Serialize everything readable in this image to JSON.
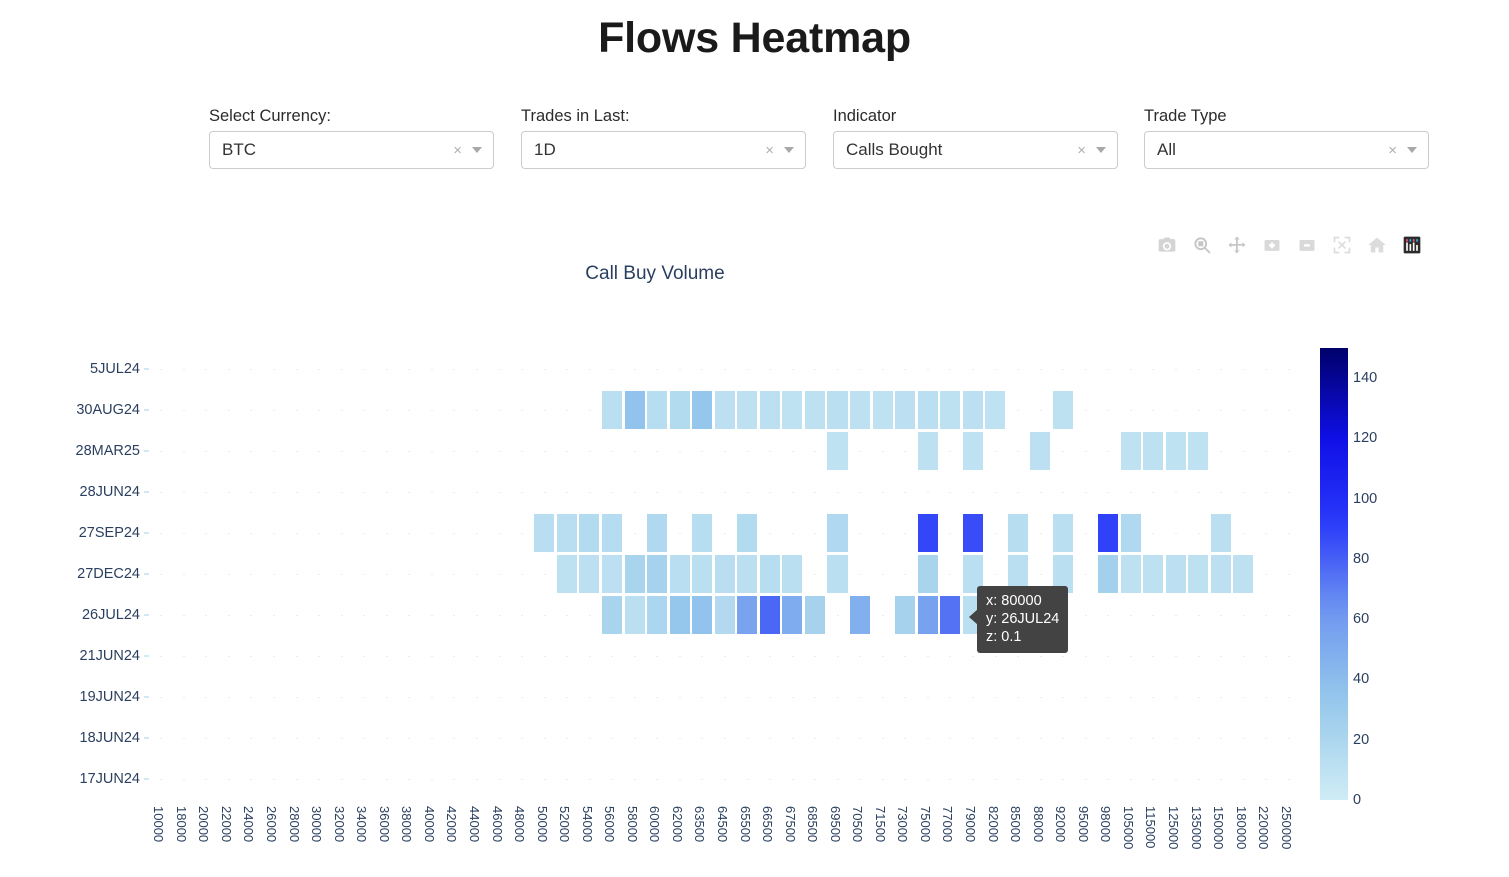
{
  "header": {
    "title": "Flows Heatmap"
  },
  "filters": [
    {
      "label": "Select Currency:",
      "value": "BTC",
      "clear": "×",
      "name": "currency"
    },
    {
      "label": "Trades in Last:",
      "value": "1D",
      "clear": "×",
      "name": "trades-in-last"
    },
    {
      "label": "Indicator",
      "value": "Calls Bought",
      "clear": "×",
      "name": "indicator"
    },
    {
      "label": "Trade Type",
      "value": "All",
      "clear": "×",
      "name": "trade-type"
    }
  ],
  "modebar": [
    {
      "name": "download-plot-icon",
      "title": "Download plot as a png"
    },
    {
      "name": "zoom-icon",
      "title": "Zoom"
    },
    {
      "name": "pan-icon",
      "title": "Pan"
    },
    {
      "name": "zoom-in-icon",
      "title": "Zoom in"
    },
    {
      "name": "zoom-out-icon",
      "title": "Zoom out"
    },
    {
      "name": "autoscale-icon",
      "title": "Autoscale"
    },
    {
      "name": "reset-axes-icon",
      "title": "Reset axes"
    },
    {
      "name": "plotly-logo-icon",
      "title": "Produced with Plotly"
    }
  ],
  "tooltip": {
    "x": "x: 80000",
    "y": "y: 26JUL24",
    "z": "z: 0.1"
  },
  "colors": {
    "title": "#1a1a1a",
    "axis_text": "#2a3f5f",
    "colorscale_low": "#cfecf5",
    "colorscale_mid": "#1515ff",
    "colorscale_high": "#00006b",
    "tooltip_bg": "#434343",
    "highlight": "#00007f"
  },
  "chart_data": {
    "type": "heatmap",
    "title": "Call Buy Volume",
    "xlabel": "",
    "ylabel": "",
    "zmin": 0,
    "zmax": 150,
    "colorbar_ticks": [
      0,
      20,
      40,
      60,
      80,
      100,
      120,
      140
    ],
    "colorbar_title": "",
    "grid": true,
    "legend_position": "right",
    "y_categories": [
      "5JUL24",
      "30AUG24",
      "28MAR25",
      "28JUN24",
      "27SEP24",
      "27DEC24",
      "26JUL24",
      "21JUN24",
      "19JUN24",
      "18JUN24",
      "17JUN24"
    ],
    "x_categories": [
      "10000",
      "18000",
      "20000",
      "22000",
      "24000",
      "26000",
      "28000",
      "30000",
      "32000",
      "34000",
      "36000",
      "38000",
      "40000",
      "42000",
      "44000",
      "46000",
      "48000",
      "50000",
      "52000",
      "54000",
      "56000",
      "58000",
      "60000",
      "62000",
      "63500",
      "64500",
      "65500",
      "66500",
      "67500",
      "68500",
      "69500",
      "70500",
      "71500",
      "73000",
      "75000",
      "77000",
      "79000",
      "82000",
      "85000",
      "88000",
      "92000",
      "95000",
      "98000",
      "105000",
      "115000",
      "125000",
      "135000",
      "150000",
      "180000",
      "220000",
      "250000"
    ],
    "hover": {
      "x": "80000",
      "y": "26JUL24",
      "z": 0.1
    },
    "cells": [
      {
        "x": "56000",
        "y": "30AUG24",
        "z": 12
      },
      {
        "x": "58000",
        "y": "30AUG24",
        "z": 36
      },
      {
        "x": "60000",
        "y": "30AUG24",
        "z": 14
      },
      {
        "x": "62000",
        "y": "30AUG24",
        "z": 16
      },
      {
        "x": "63500",
        "y": "30AUG24",
        "z": 34
      },
      {
        "x": "64500",
        "y": "30AUG24",
        "z": 11
      },
      {
        "x": "65500",
        "y": "30AUG24",
        "z": 10
      },
      {
        "x": "66500",
        "y": "30AUG24",
        "z": 11
      },
      {
        "x": "67500",
        "y": "30AUG24",
        "z": 9
      },
      {
        "x": "68500",
        "y": "30AUG24",
        "z": 10
      },
      {
        "x": "69500",
        "y": "30AUG24",
        "z": 12
      },
      {
        "x": "70500",
        "y": "30AUG24",
        "z": 10
      },
      {
        "x": "71500",
        "y": "30AUG24",
        "z": 9
      },
      {
        "x": "73000",
        "y": "30AUG24",
        "z": 11
      },
      {
        "x": "75000",
        "y": "30AUG24",
        "z": 12
      },
      {
        "x": "77000",
        "y": "30AUG24",
        "z": 10
      },
      {
        "x": "79000",
        "y": "30AUG24",
        "z": 11
      },
      {
        "x": "82000",
        "y": "30AUG24",
        "z": 9
      },
      {
        "x": "92000",
        "y": "30AUG24",
        "z": 10
      },
      {
        "x": "69500",
        "y": "28MAR25",
        "z": 9
      },
      {
        "x": "75000",
        "y": "28MAR25",
        "z": 10
      },
      {
        "x": "79000",
        "y": "28MAR25",
        "z": 9
      },
      {
        "x": "88000",
        "y": "28MAR25",
        "z": 11
      },
      {
        "x": "105000",
        "y": "28MAR25",
        "z": 9
      },
      {
        "x": "115000",
        "y": "28MAR25",
        "z": 10
      },
      {
        "x": "125000",
        "y": "28MAR25",
        "z": 9
      },
      {
        "x": "135000",
        "y": "28MAR25",
        "z": 9
      },
      {
        "x": "50000",
        "y": "27SEP24",
        "z": 13
      },
      {
        "x": "52000",
        "y": "27SEP24",
        "z": 13
      },
      {
        "x": "54000",
        "y": "27SEP24",
        "z": 16
      },
      {
        "x": "56000",
        "y": "27SEP24",
        "z": 15
      },
      {
        "x": "60000",
        "y": "27SEP24",
        "z": 18
      },
      {
        "x": "63500",
        "y": "27SEP24",
        "z": 14
      },
      {
        "x": "65500",
        "y": "27SEP24",
        "z": 16
      },
      {
        "x": "69500",
        "y": "27SEP24",
        "z": 18
      },
      {
        "x": "75000",
        "y": "27SEP24",
        "z": 88
      },
      {
        "x": "79000",
        "y": "27SEP24",
        "z": 86
      },
      {
        "x": "85000",
        "y": "27SEP24",
        "z": 14
      },
      {
        "x": "92000",
        "y": "27SEP24",
        "z": 12
      },
      {
        "x": "98000",
        "y": "27SEP24",
        "z": 90
      },
      {
        "x": "105000",
        "y": "27SEP24",
        "z": 18
      },
      {
        "x": "150000",
        "y": "27SEP24",
        "z": 12
      },
      {
        "x": "52000",
        "y": "27DEC24",
        "z": 10
      },
      {
        "x": "54000",
        "y": "27DEC24",
        "z": 11
      },
      {
        "x": "56000",
        "y": "27DEC24",
        "z": 11
      },
      {
        "x": "58000",
        "y": "27DEC24",
        "z": 22
      },
      {
        "x": "60000",
        "y": "27DEC24",
        "z": 24
      },
      {
        "x": "62000",
        "y": "27DEC24",
        "z": 13
      },
      {
        "x": "63500",
        "y": "27DEC24",
        "z": 12
      },
      {
        "x": "64500",
        "y": "27DEC24",
        "z": 13
      },
      {
        "x": "65500",
        "y": "27DEC24",
        "z": 12
      },
      {
        "x": "66500",
        "y": "27DEC24",
        "z": 14
      },
      {
        "x": "67500",
        "y": "27DEC24",
        "z": 12
      },
      {
        "x": "69500",
        "y": "27DEC24",
        "z": 12
      },
      {
        "x": "75000",
        "y": "27DEC24",
        "z": 22
      },
      {
        "x": "79000",
        "y": "27DEC24",
        "z": 12
      },
      {
        "x": "85000",
        "y": "27DEC24",
        "z": 12
      },
      {
        "x": "92000",
        "y": "27DEC24",
        "z": 12
      },
      {
        "x": "98000",
        "y": "27DEC24",
        "z": 26
      },
      {
        "x": "105000",
        "y": "27DEC24",
        "z": 10
      },
      {
        "x": "115000",
        "y": "27DEC24",
        "z": 10
      },
      {
        "x": "125000",
        "y": "27DEC24",
        "z": 11
      },
      {
        "x": "135000",
        "y": "27DEC24",
        "z": 10
      },
      {
        "x": "150000",
        "y": "27DEC24",
        "z": 11
      },
      {
        "x": "180000",
        "y": "27DEC24",
        "z": 10
      },
      {
        "x": "56000",
        "y": "26JUL24",
        "z": 22
      },
      {
        "x": "58000",
        "y": "26JUL24",
        "z": 12
      },
      {
        "x": "60000",
        "y": "26JUL24",
        "z": 20
      },
      {
        "x": "62000",
        "y": "26JUL24",
        "z": 34
      },
      {
        "x": "63500",
        "y": "26JUL24",
        "z": 36
      },
      {
        "x": "64500",
        "y": "26JUL24",
        "z": 17
      },
      {
        "x": "65500",
        "y": "26JUL24",
        "z": 55
      },
      {
        "x": "66500",
        "y": "26JUL24",
        "z": 78
      },
      {
        "x": "67500",
        "y": "26JUL24",
        "z": 50
      },
      {
        "x": "68500",
        "y": "26JUL24",
        "z": 24
      },
      {
        "x": "70500",
        "y": "26JUL24",
        "z": 48
      },
      {
        "x": "73000",
        "y": "26JUL24",
        "z": 24
      },
      {
        "x": "75000",
        "y": "26JUL24",
        "z": 56
      },
      {
        "x": "77000",
        "y": "26JUL24",
        "z": 74
      },
      {
        "x": "79000",
        "y": "26JUL24",
        "z": 12
      },
      {
        "x": "82000",
        "y": "26JUL24",
        "z": 11
      },
      {
        "x": "85000",
        "y": "26JUL24",
        "z": 22
      },
      {
        "x": "88000",
        "y": "26JUL24",
        "z": 12
      },
      {
        "x": "80000",
        "y": "26JUL24",
        "z": 0.1
      }
    ]
  }
}
